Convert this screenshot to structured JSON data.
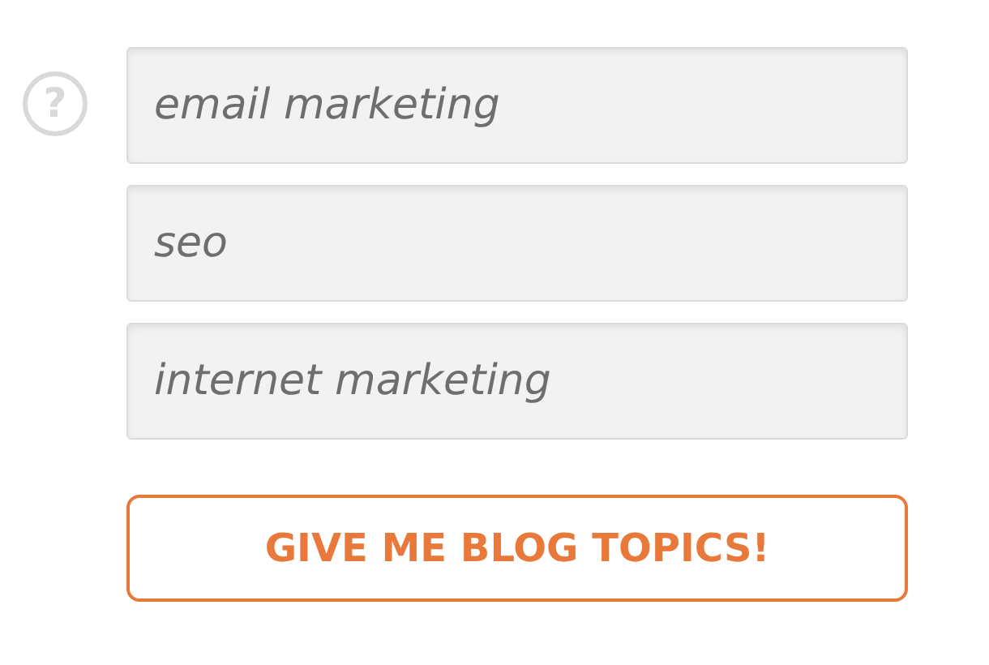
{
  "help_icon": {
    "glyph": "?"
  },
  "fields": [
    {
      "placeholder": "email marketing"
    },
    {
      "placeholder": "seo"
    },
    {
      "placeholder": "internet marketing"
    }
  ],
  "submit_button": {
    "label": "GIVE ME BLOG TOPICS!"
  }
}
